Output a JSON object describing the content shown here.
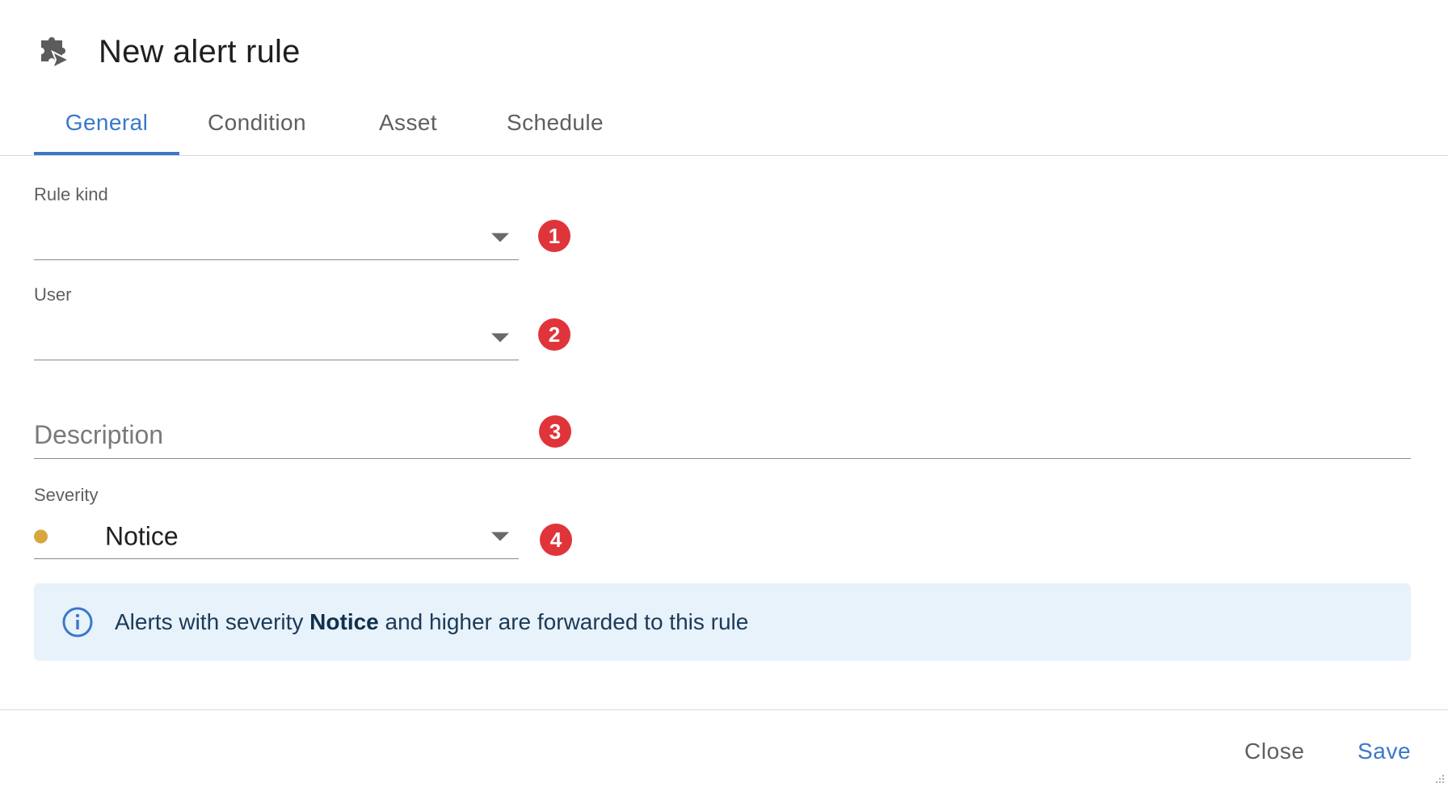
{
  "header": {
    "title": "New alert rule",
    "icon": "puzzle-send-icon"
  },
  "tabs": [
    {
      "label": "General",
      "active": true
    },
    {
      "label": "Condition",
      "active": false
    },
    {
      "label": "Asset",
      "active": false
    },
    {
      "label": "Schedule",
      "active": false
    }
  ],
  "form": {
    "rule_kind": {
      "label": "Rule kind",
      "value": ""
    },
    "user": {
      "label": "User",
      "value": ""
    },
    "description": {
      "placeholder": "Description",
      "value": ""
    },
    "severity": {
      "label": "Severity",
      "value": "Notice",
      "dot_color": "#d6a73c"
    }
  },
  "badges": [
    "1",
    "2",
    "3",
    "4"
  ],
  "info": {
    "text_before": "Alerts with severity ",
    "severity": "Notice",
    "text_after": " and higher are forwarded to this rule"
  },
  "footer": {
    "close_label": "Close",
    "save_label": "Save"
  },
  "colors": {
    "accent": "#3a78c9",
    "badge": "#e0343b",
    "info_bg": "#e7f2fb"
  }
}
